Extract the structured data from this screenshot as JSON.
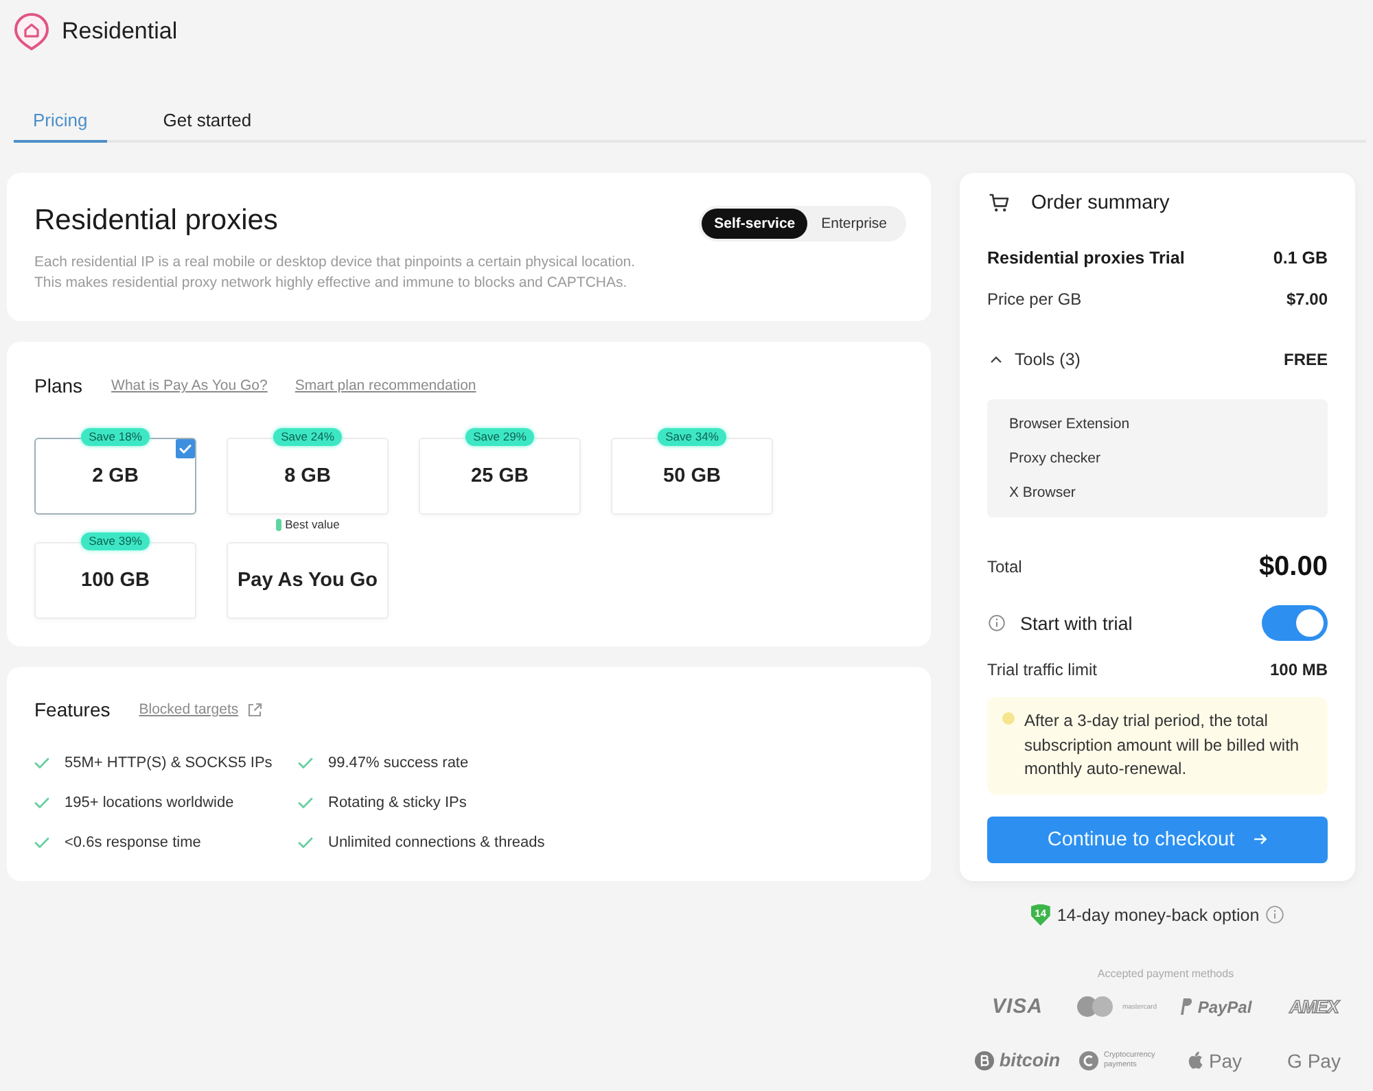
{
  "header": {
    "title": "Residential"
  },
  "tabs": [
    {
      "label": "Pricing",
      "selected": true
    },
    {
      "label": "Get started",
      "selected": false
    }
  ],
  "product": {
    "title": "Residential proxies",
    "description": "Each residential IP is a real mobile or desktop device that pinpoints a certain physical location.\nThis makes residential proxy network highly effective and immune to blocks and CAPTCHAs.",
    "modes": [
      {
        "label": "Self-service",
        "selected": true
      },
      {
        "label": "Enterprise",
        "selected": false
      }
    ]
  },
  "plans": {
    "title": "Plans",
    "links": [
      "What is Pay As You Go?",
      "Smart plan recommendation"
    ],
    "options": [
      {
        "label": "2 GB",
        "badge": "Save 18%",
        "selected": true
      },
      {
        "label": "8 GB",
        "badge": "Save 24%",
        "note": "Best value",
        "selected": false
      },
      {
        "label": "25 GB",
        "badge": "Save 29%",
        "selected": false
      },
      {
        "label": "50 GB",
        "badge": "Save 34%",
        "selected": false
      },
      {
        "label": "100 GB",
        "badge": "Save 39%",
        "selected": false
      },
      {
        "label": "Pay As You Go",
        "selected": false
      }
    ]
  },
  "features": {
    "title": "Features",
    "link": "Blocked targets",
    "items": [
      "55M+ HTTP(S) & SOCKS5 IPs",
      "99.47% success rate",
      "195+ locations worldwide",
      "Rotating & sticky IPs",
      "<0.6s response time",
      "Unlimited connections & threads"
    ]
  },
  "order_summary": {
    "title": "Order summary",
    "product": {
      "label": "Residential proxies Trial",
      "value": "0.1 GB"
    },
    "price": {
      "label": "Price per GB",
      "value": "$7.00"
    },
    "tools": {
      "label": "Tools (3)",
      "value": "FREE",
      "expanded": true,
      "items": [
        "Browser Extension",
        "Proxy checker",
        "X Browser"
      ]
    },
    "total": {
      "label": "Total",
      "value": "$0.00"
    },
    "trial": {
      "label": "Start with trial",
      "on": true
    },
    "trial_limit": {
      "label": "Trial traffic limit",
      "value": "100 MB"
    },
    "notice": "After a 3-day trial period, the total subscription amount will be billed with monthly auto-renewal.",
    "checkout_button": "Continue to checkout"
  },
  "guarantee": {
    "badge": "14",
    "label": "14-day money-back option"
  },
  "payments": {
    "title": "Accepted payment methods",
    "methods": [
      {
        "kind": "visa",
        "label": "VISA"
      },
      {
        "kind": "mastercard",
        "label": "mastercard"
      },
      {
        "kind": "paypal",
        "label": "PayPal"
      },
      {
        "kind": "amex",
        "label": "AMEX"
      },
      {
        "kind": "bitcoin",
        "label": "bitcoin"
      },
      {
        "kind": "crypto",
        "label": "Cryptocurrency payments"
      },
      {
        "kind": "applepay",
        "label": "Pay"
      },
      {
        "kind": "googlepay",
        "label": "G Pay"
      }
    ]
  }
}
